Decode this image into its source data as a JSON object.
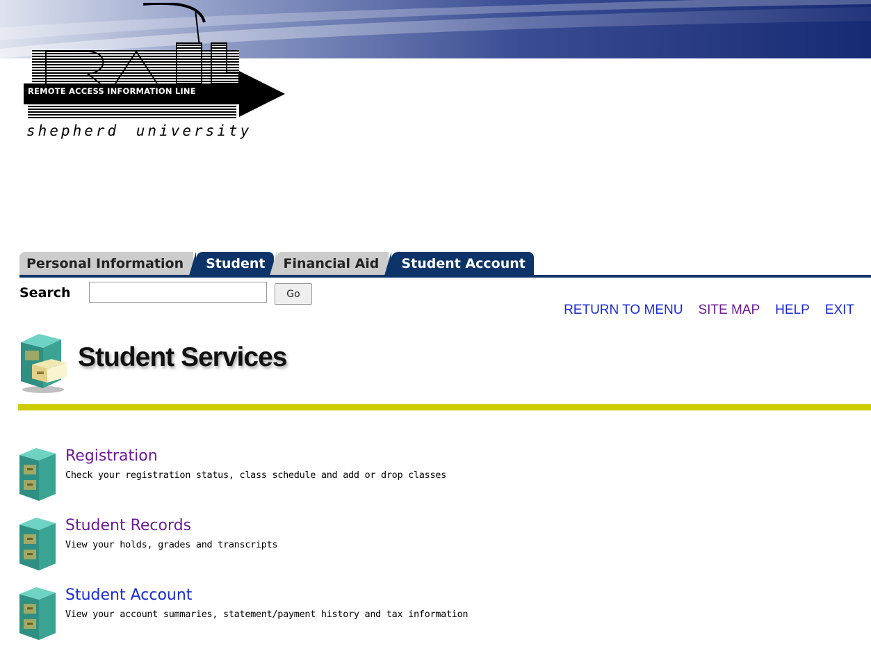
{
  "header": {
    "logo_text": "RAIL",
    "logo_line": "REMOTE ACCESS INFORMATION LINE",
    "tagline": "shepherd university"
  },
  "tabs": [
    {
      "label": "Personal Information",
      "active": false
    },
    {
      "label": "Student",
      "active": true
    },
    {
      "label": "Financial Aid",
      "active": false
    },
    {
      "label": "Student Account",
      "active": true
    }
  ],
  "search": {
    "label": "Search",
    "value": "",
    "placeholder": "",
    "button_label": "Go"
  },
  "top_links": [
    {
      "label": "RETURN TO MENU",
      "color": "#1a2bd6"
    },
    {
      "label": "SITE MAP",
      "color": "#6a1b9a"
    },
    {
      "label": "HELP",
      "color": "#1a2bd6"
    },
    {
      "label": "EXIT",
      "color": "#1a2bd6"
    }
  ],
  "page": {
    "title": "Student Services",
    "title_icon": "file-cabinet-open-icon"
  },
  "menu": [
    {
      "label": "Registration",
      "description": "Check your registration status, class schedule and add or drop classes",
      "icon": "file-cabinet-icon",
      "visited": true
    },
    {
      "label": "Student Records",
      "description": "View your holds, grades and transcripts",
      "icon": "file-cabinet-icon",
      "visited": true
    },
    {
      "label": "Student Account",
      "description": "View your account summaries, statement/payment history and tax information",
      "icon": "file-cabinet-icon",
      "visited": false
    }
  ],
  "colors": {
    "tab_active": "#0c3468",
    "tab_inactive": "#cccccc",
    "divider": "#cccc00",
    "link_blue": "#1a2bd6",
    "link_visited": "#6a1b9a",
    "cabinet": "#3aa394"
  }
}
